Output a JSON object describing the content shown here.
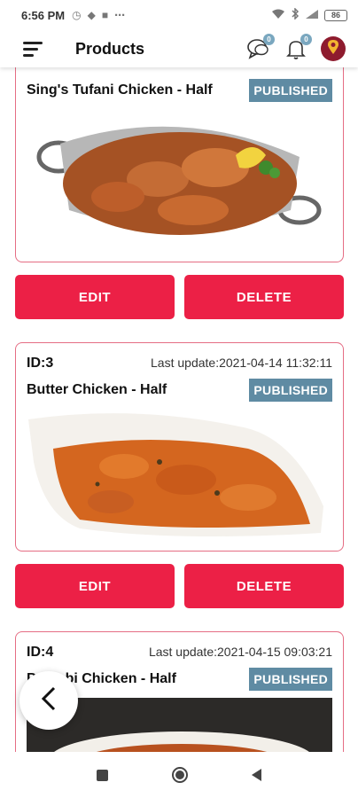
{
  "status_bar": {
    "time": "6:56 PM",
    "battery": "86"
  },
  "app_bar": {
    "title": "Products",
    "chat_badge": "0",
    "notification_badge": "0"
  },
  "products": [
    {
      "title": "Sing's Tufani Chicken - Half",
      "status": "PUBLISHED",
      "edit_label": "EDIT",
      "delete_label": "DELETE"
    },
    {
      "id": "ID:3",
      "updated": "Last update:2021-04-14 11:32:11",
      "title": "Butter Chicken - Half",
      "status": "PUBLISHED",
      "edit_label": "EDIT",
      "delete_label": "DELETE"
    },
    {
      "id": "ID:4",
      "updated": "Last update:2021-04-15 09:03:21",
      "title": "Punjabi Chicken - Half",
      "status": "PUBLISHED"
    }
  ],
  "colors": {
    "accent": "#ec2046",
    "card_border": "#e56d84",
    "badge": "#5f8ba3"
  }
}
